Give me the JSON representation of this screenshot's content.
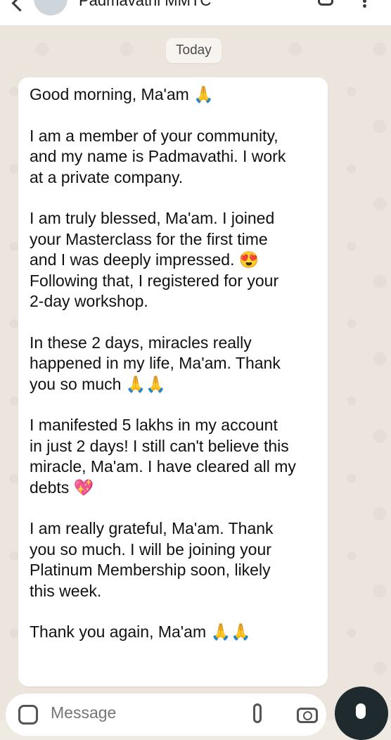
{
  "header": {
    "contact_name": "Padmavathi MMTC"
  },
  "date_chip": "Today",
  "message": {
    "paragraphs": [
      "Good morning, Ma'am 🙏",
      "I am a member of your community,\nand my name is Padmavathi. I work\nat a private company.",
      "I am truly blessed, Ma'am. I joined\nyour Masterclass for the first time\nand I was deeply impressed. 😍\nFollowing that, I registered for your\n2-day workshop.",
      "In these 2 days, miracles really\nhappened in my life, Ma'am. Thank\nyou so much 🙏🙏",
      "I manifested 5 lakhs in my account\nin just 2 days! I still can't believe this\nmiracle, Ma'am. I have cleared all my\ndebts 💖",
      "I am really grateful, Ma'am. Thank\nyou so much. I will be joining your\nPlatinum Membership soon, likely\nthis week.",
      "Thank you again, Ma'am 🙏🙏"
    ]
  },
  "composer": {
    "placeholder": "Message"
  },
  "icons": {
    "back": "back-arrow-icon",
    "call": "call-icon",
    "more": "more-options-icon",
    "emoji": "emoji-icon",
    "attach": "attach-icon",
    "camera": "camera-icon",
    "mic": "mic-icon"
  },
  "colors": {
    "chat_background": "#ece5dd",
    "bubble": "#ffffff",
    "mic_button": "#1f2a2e"
  }
}
